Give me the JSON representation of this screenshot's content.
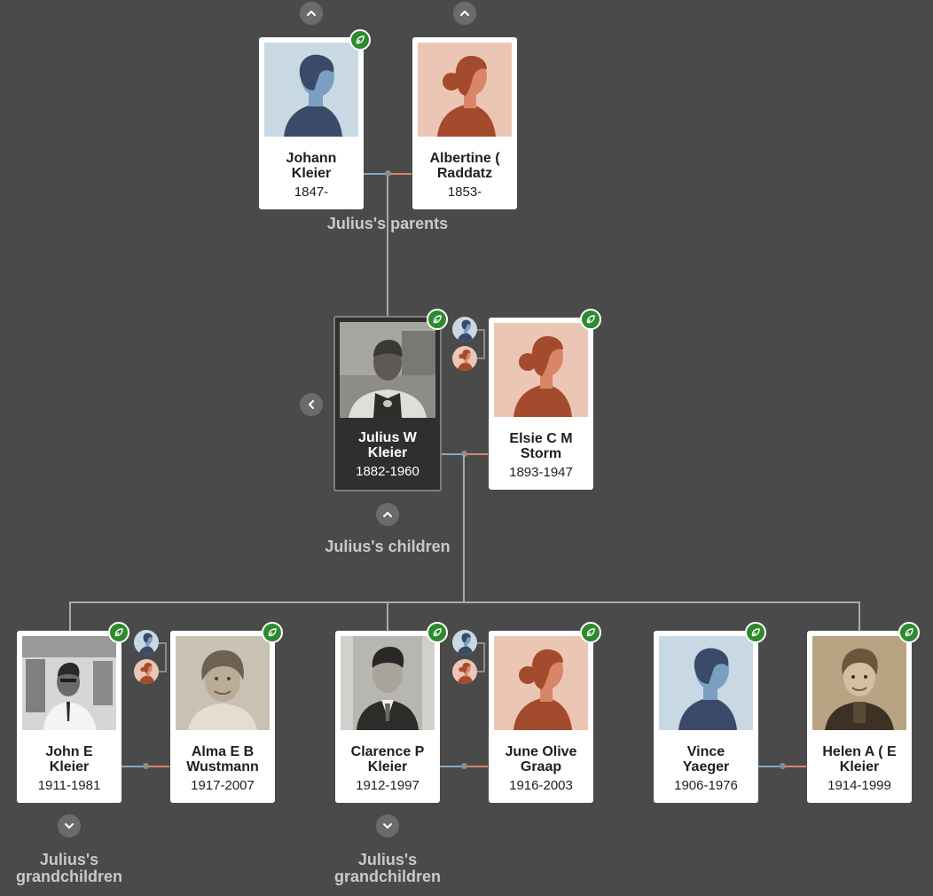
{
  "labels": {
    "parents": "Julius's parents",
    "children": "Julius's children",
    "grandchildren_1": "Julius's\ngrandchildren",
    "grandchildren_2": "Julius's\ngrandchildren"
  },
  "icons": {
    "hint": "leaf-hint-icon",
    "expand_up": "chevron-up-icon",
    "expand_down": "chevron-down-icon",
    "back": "chevron-left-icon"
  },
  "colors": {
    "background": "#4a4a4a",
    "hint_green": "#2d8a2e",
    "male_line": "#86a9c6",
    "female_line": "#d9866b"
  },
  "people": {
    "johann": {
      "name": "Johann\nKleier",
      "years": "1847-",
      "avatar": "male-silhouette"
    },
    "albertine": {
      "name": "Albertine (\nRaddatz",
      "years": "1853-",
      "avatar": "female-silhouette"
    },
    "julius": {
      "name": "Julius W\nKleier",
      "years": "1882-1960",
      "avatar": "photo"
    },
    "elsie": {
      "name": "Elsie C M\nStorm",
      "years": "1893-1947",
      "avatar": "female-silhouette"
    },
    "john": {
      "name": "John E\nKleier",
      "years": "1911-1981",
      "avatar": "photo"
    },
    "alma": {
      "name": "Alma E B\nWustmann",
      "years": "1917-2007",
      "avatar": "photo"
    },
    "clarence": {
      "name": "Clarence P\nKleier",
      "years": "1912-1997",
      "avatar": "photo"
    },
    "june": {
      "name": "June Olive\nGraap",
      "years": "1916-2003",
      "avatar": "female-silhouette"
    },
    "vince": {
      "name": "Vince\nYaeger",
      "years": "1906-1976",
      "avatar": "male-silhouette"
    },
    "helen": {
      "name": "Helen A ( E\nKleier",
      "years": "1914-1999",
      "avatar": "photo"
    }
  }
}
